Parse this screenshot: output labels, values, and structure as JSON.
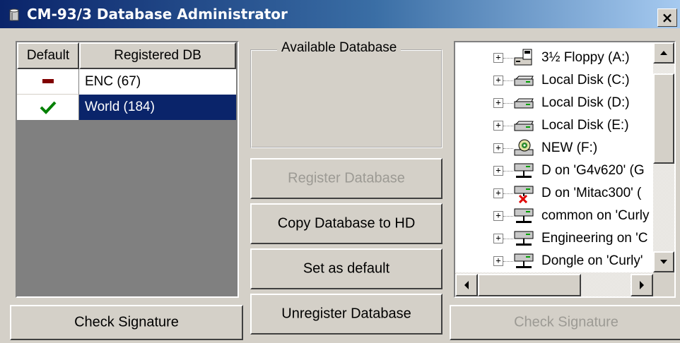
{
  "window": {
    "title": "CM-93/3 Database Administrator",
    "close_label": "×"
  },
  "registered_db": {
    "columns": [
      "Default",
      "Registered DB"
    ],
    "rows": [
      {
        "name": "ENC (67)",
        "default_mark": "dash",
        "selected": false
      },
      {
        "name": "World (184)",
        "default_mark": "check",
        "selected": true
      }
    ]
  },
  "available_database": {
    "label": "Available Database"
  },
  "buttons": {
    "register": "Register Database",
    "copy_to_hd": "Copy Database to HD",
    "set_default": "Set as default",
    "unregister": "Unregister Database",
    "check_signature_left": "Check Signature",
    "check_signature_right": "Check Signature"
  },
  "drive_tree": [
    {
      "label": "3½ Floppy (A:)",
      "icon": "floppy-drive-icon"
    },
    {
      "label": "Local Disk (C:)",
      "icon": "hard-disk-icon"
    },
    {
      "label": "Local Disk (D:)",
      "icon": "hard-disk-icon"
    },
    {
      "label": "Local Disk (E:)",
      "icon": "hard-disk-icon"
    },
    {
      "label": "NEW (F:)",
      "icon": "cd-drive-icon"
    },
    {
      "label": "D on 'G4v620' (G",
      "icon": "network-drive-icon"
    },
    {
      "label": "D on 'Mitac300' (",
      "icon": "disconnected-network-drive-icon"
    },
    {
      "label": "common on 'Curly",
      "icon": "network-drive-icon"
    },
    {
      "label": "Engineering on 'C",
      "icon": "network-drive-icon"
    },
    {
      "label": "Dongle on 'Curly'",
      "icon": "network-drive-icon"
    }
  ],
  "colors": {
    "selection": "#0a246a",
    "check": "#008000",
    "dash": "#800000",
    "face": "#d4d0c8"
  }
}
